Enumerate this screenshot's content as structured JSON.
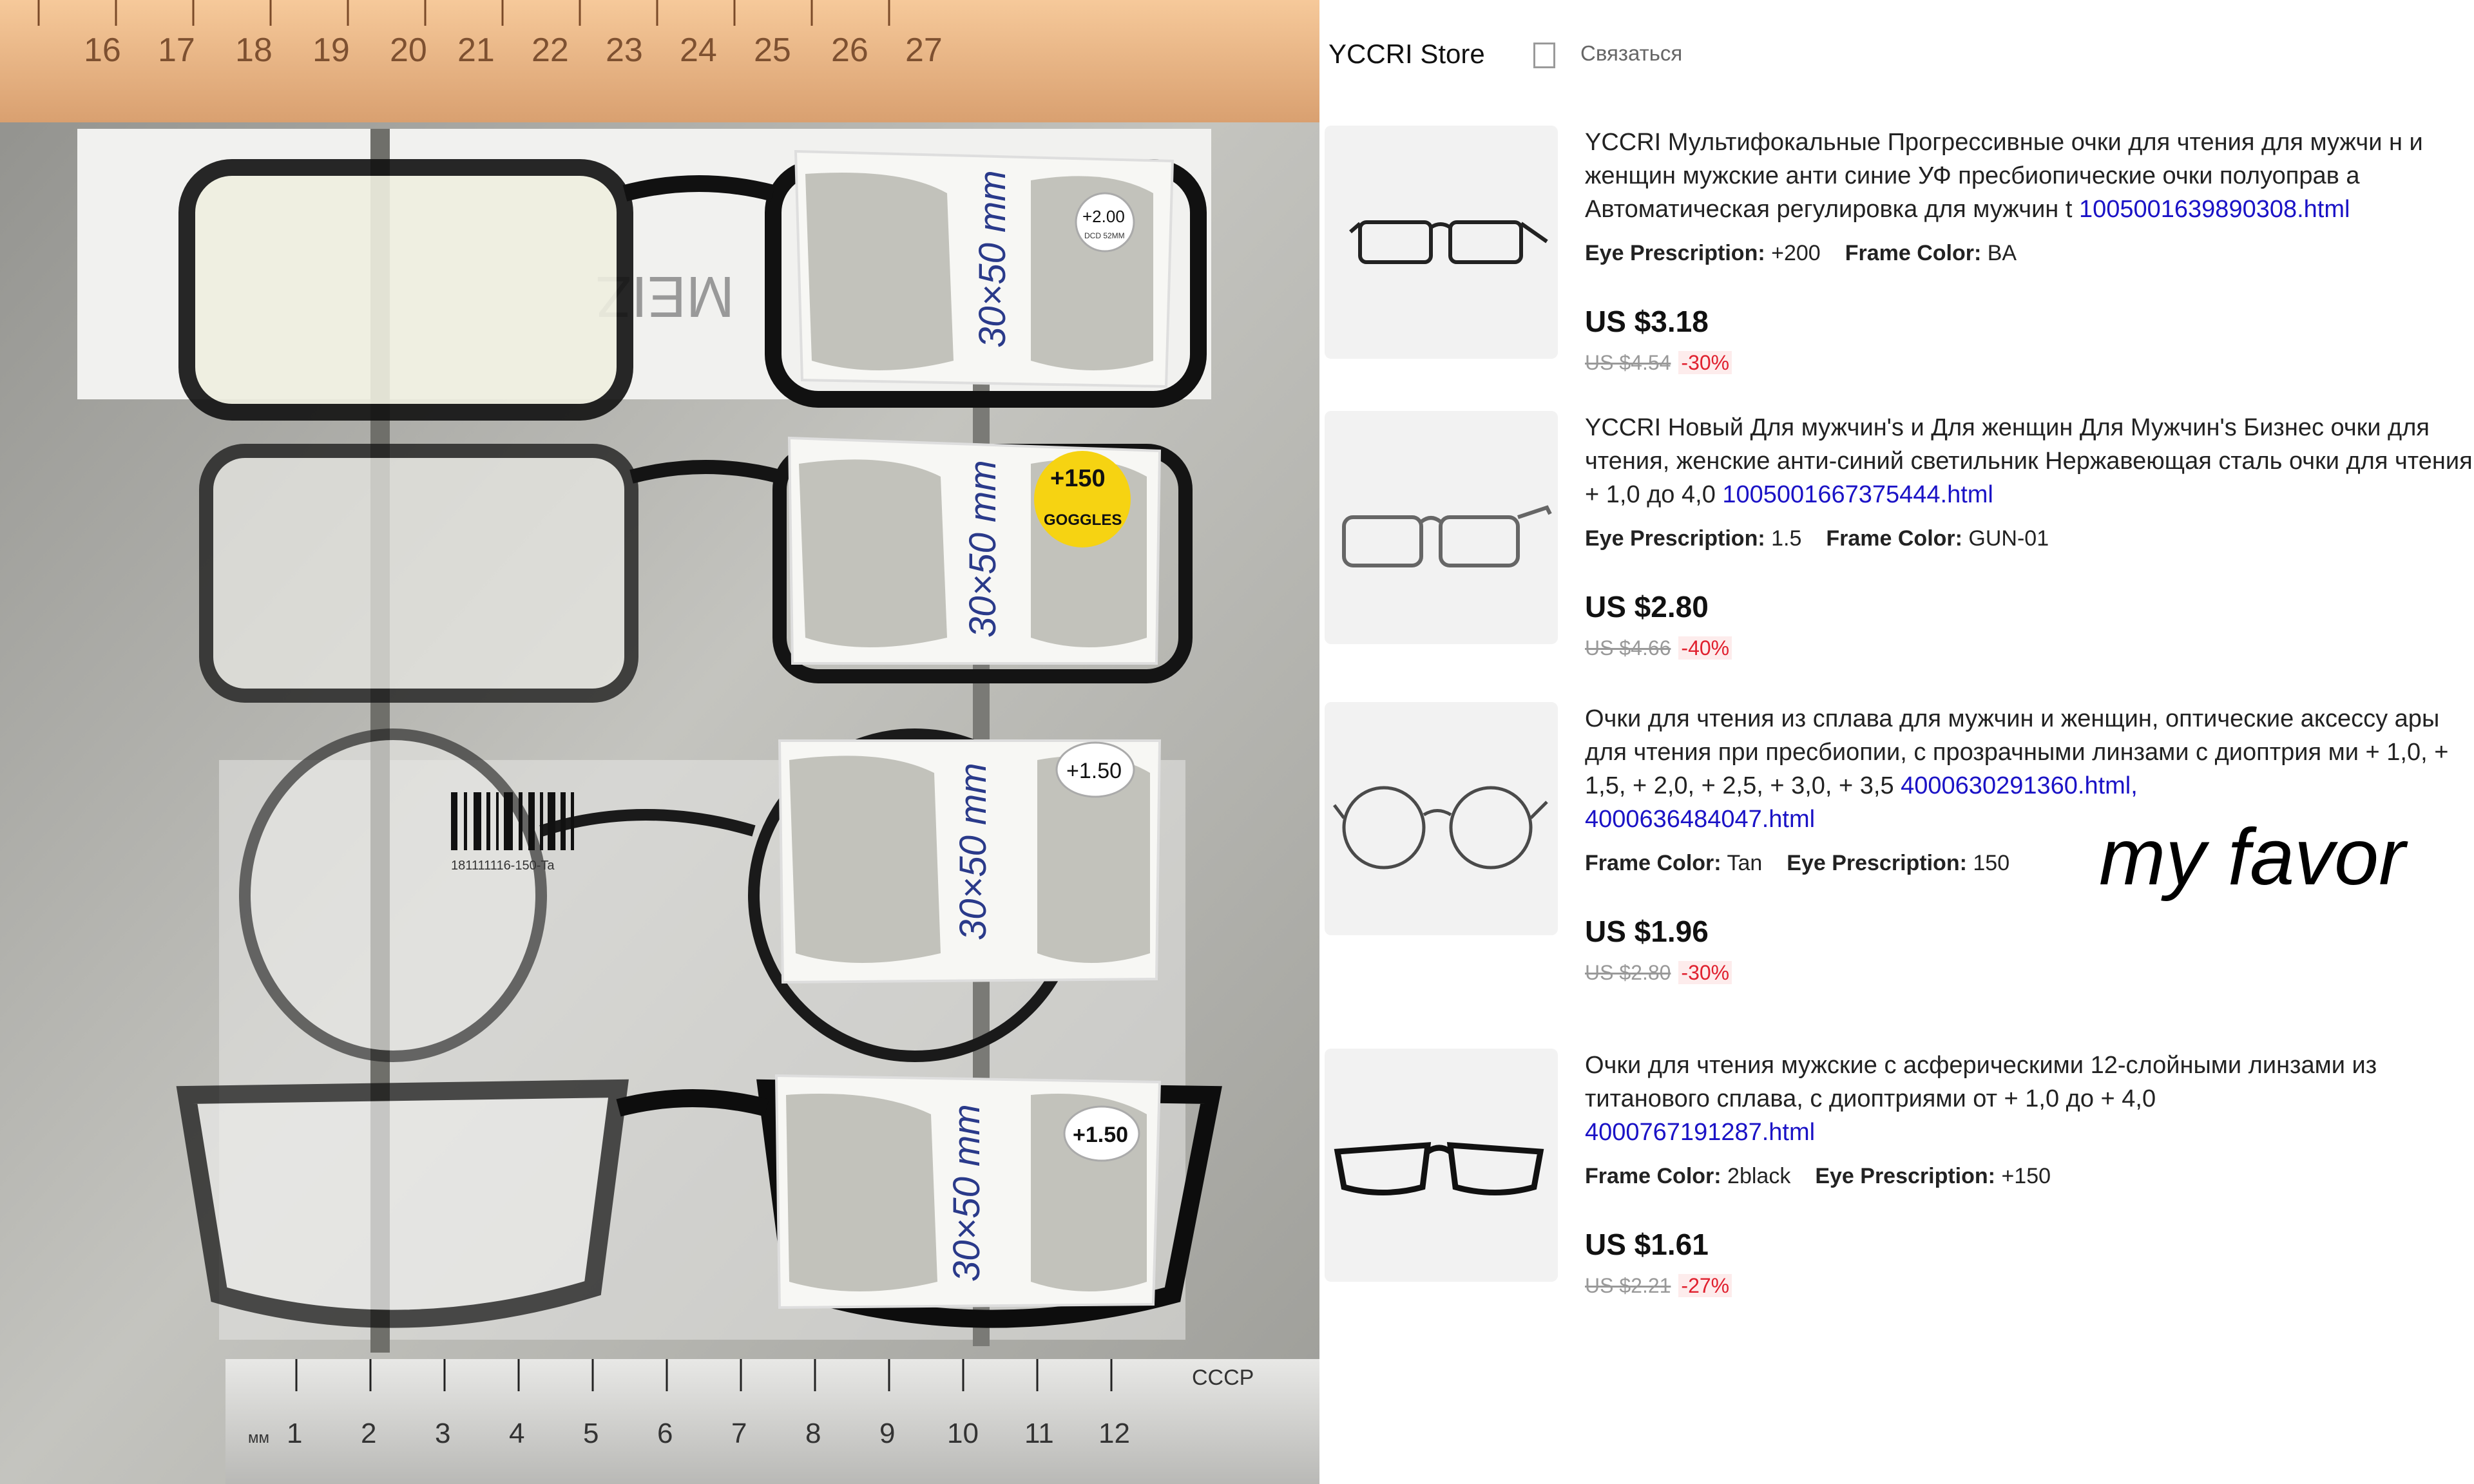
{
  "store": {
    "name": "YCCRI Store",
    "contact_label": "Связаться"
  },
  "photo": {
    "ruler_top_marks": [
      "16",
      "17",
      "18",
      "19",
      "20",
      "21",
      "22",
      "23",
      "24",
      "25",
      "26",
      "27"
    ],
    "ruler_bottom_marks": [
      "1",
      "2",
      "3",
      "4",
      "5",
      "6",
      "7",
      "8",
      "9",
      "10",
      "11",
      "12"
    ],
    "ruler_bottom_prefix": "мм",
    "ruler_bottom_brand": "СССР",
    "lens_note": "30×50 mm",
    "stickers": [
      "+2.00",
      "+150",
      "+1.50",
      "+1.50"
    ],
    "sticker_sub_1": "DCD 52MM",
    "sticker_sub_2": "GOGGLES",
    "box_logo": "MEIZ",
    "barcode_text": "181111116-150-Ta"
  },
  "items": [
    {
      "title": "YCCRI Мультифокальные Прогрессивные очки для чтения для мужчи н и женщин мужские анти синие УФ пресбиопические очки полуоправ а Автоматическая регулировка для мужчин t ",
      "link": "1005001639890308.html",
      "attr1_label": "Eye Prescription:",
      "attr1_value": "+200",
      "attr2_label": "Frame Color:",
      "attr2_value": "BA",
      "price": "US $3.18",
      "old_price": "US $4.54",
      "discount": "-30%"
    },
    {
      "title": "YCCRI Новый Для мужчин's и Для женщин Для Мужчин's Бизнес очки для чтения, женские анти-синий светильник Нержавеющая сталь очки для чтения + 1,0 до 4,0 ",
      "link": "1005001667375444.html",
      "attr1_label": "Eye Prescription:",
      "attr1_value": "1.5",
      "attr2_label": "Frame Color:",
      "attr2_value": "GUN-01",
      "price": "US $2.80",
      "old_price": "US $4.66",
      "discount": "-40%"
    },
    {
      "title": "Очки для чтения из сплава для мужчин и женщин, оптические аксессу ары для чтения при пресбиопии, с прозрачными линзами с диоптрия ми + 1,0, + 1,5, + 2,0, + 2,5, + 3,0, + 3,5 ",
      "link": "4000630291360.html,",
      "link2": "4000636484047.html",
      "attr1_label": "Frame Color:",
      "attr1_value": "Tan",
      "attr2_label": "Eye Prescription:",
      "attr2_value": "150",
      "price": "US $1.96",
      "old_price": "US $2.80",
      "discount": "-30%"
    },
    {
      "title": "Очки для чтения мужские с асферическими 12-слойными линзами из титанового сплава, с диоптриями от + 1,0 до + 4,0 ",
      "link": "4000767191287.html",
      "attr1_label": "Frame Color:",
      "attr1_value": "2black",
      "attr2_label": "Eye Prescription:",
      "attr2_value": "+150",
      "price": "US $1.61",
      "old_price": "US $2.21",
      "discount": "-27%"
    }
  ],
  "annotation": "my favor"
}
